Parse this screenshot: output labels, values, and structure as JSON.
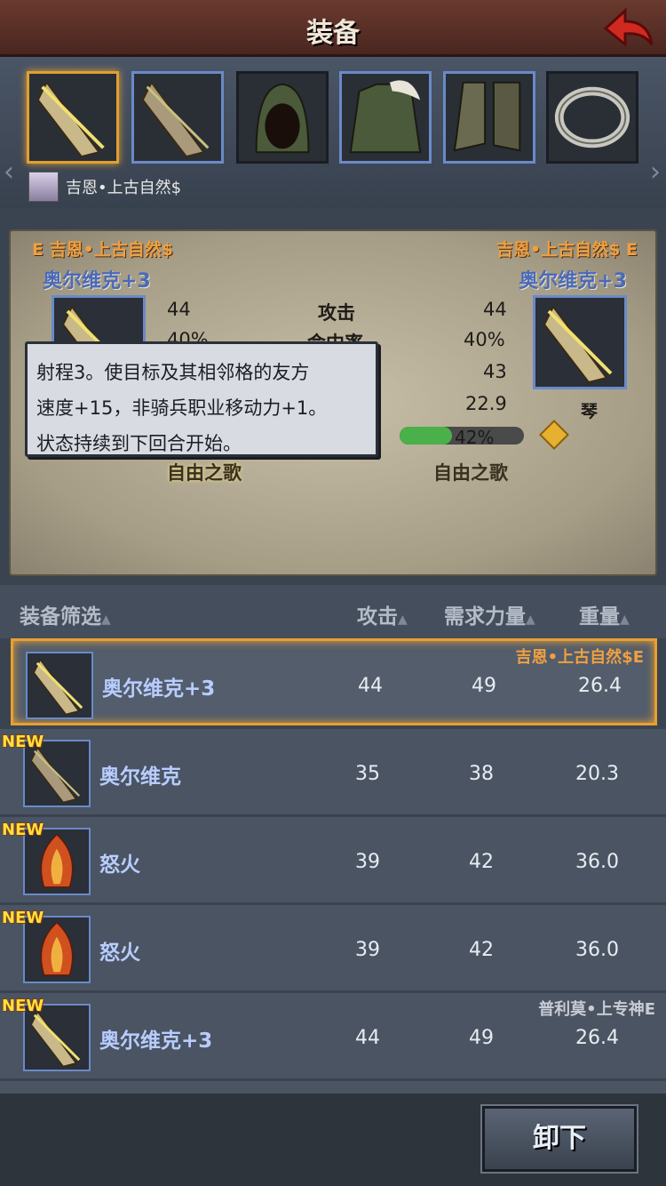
{
  "header": {
    "title": "装备"
  },
  "character": {
    "name": "吉恩•上古自然$"
  },
  "compare": {
    "left_owner": "E 吉恩•上古自然$",
    "right_owner": "吉恩•上古自然$ E",
    "left_weapon": "奥尔维克+3",
    "right_weapon": "奥尔维克+3",
    "right_type": "琴",
    "stats": [
      {
        "label": "攻击",
        "left": "44",
        "right": "44"
      },
      {
        "label": "命中率",
        "left": "40%",
        "right": "40%"
      },
      {
        "label": "",
        "left": "",
        "right": "43"
      },
      {
        "label": "",
        "left": "",
        "right": "22.9"
      }
    ],
    "durability": {
      "label": "42%",
      "value": 0.42
    },
    "skill_left": "自由之歌",
    "skill_right": "自由之歌"
  },
  "tooltip": {
    "line1": "射程3。使目标及其相邻格的友方",
    "line2": "速度+15，非骑兵职业移动力+1。",
    "line3": "状态持续到下回合开始。"
  },
  "filters": {
    "filter_label": "装备筛选",
    "col1": "攻击",
    "col2": "需求力量",
    "col3": "重量"
  },
  "items": [
    {
      "name": "奥尔维克+3",
      "atk": "44",
      "str": "49",
      "weight": "26.4",
      "owner": "吉恩•上古自然$E",
      "new": ""
    },
    {
      "name": "奥尔维克",
      "atk": "35",
      "str": "38",
      "weight": "20.3",
      "owner": "",
      "new": "NEW"
    },
    {
      "name": "怒火",
      "atk": "39",
      "str": "42",
      "weight": "36.0",
      "owner": "",
      "new": "NEW"
    },
    {
      "name": "怒火",
      "atk": "39",
      "str": "42",
      "weight": "36.0",
      "owner": "",
      "new": "NEW"
    },
    {
      "name": "奥尔维克+3",
      "atk": "44",
      "str": "49",
      "weight": "26.4",
      "owner": "普利莫•上专神E",
      "new": "NEW"
    }
  ],
  "actions": {
    "unequip": "卸下"
  },
  "colors": {
    "accent": "#e8a030",
    "blue_text": "#b8ccff"
  }
}
